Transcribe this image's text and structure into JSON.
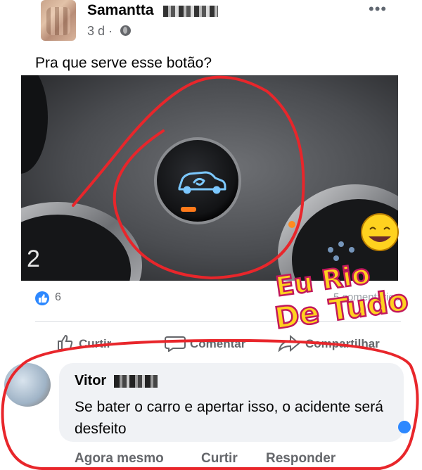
{
  "post": {
    "author": "Samantta",
    "time": "3 d ·",
    "caption": "Pra que serve esse botão?",
    "more_icon": "•••",
    "reactions": {
      "count": "6",
      "comments": "5 comentários"
    },
    "actions": {
      "like": "Curtir",
      "comment": "Comentar",
      "share": "Compartilhar"
    }
  },
  "photo": {
    "button_icon": "car-recirculation-icon",
    "dial_number": "2",
    "watermark_line1": "Eu Rio",
    "watermark_line2": "De Tudo"
  },
  "comment": {
    "author": "Vitor",
    "text": "Se bater o carro e apertar isso, o acidente será desfeito",
    "time": "Agora mesmo",
    "like": "Curtir",
    "reply": "Responder"
  },
  "colors": {
    "accent": "#2d88ff",
    "annotation_red": "#e8262b",
    "watermark_yellow": "#ffd21f",
    "watermark_pink": "#c2185b"
  }
}
